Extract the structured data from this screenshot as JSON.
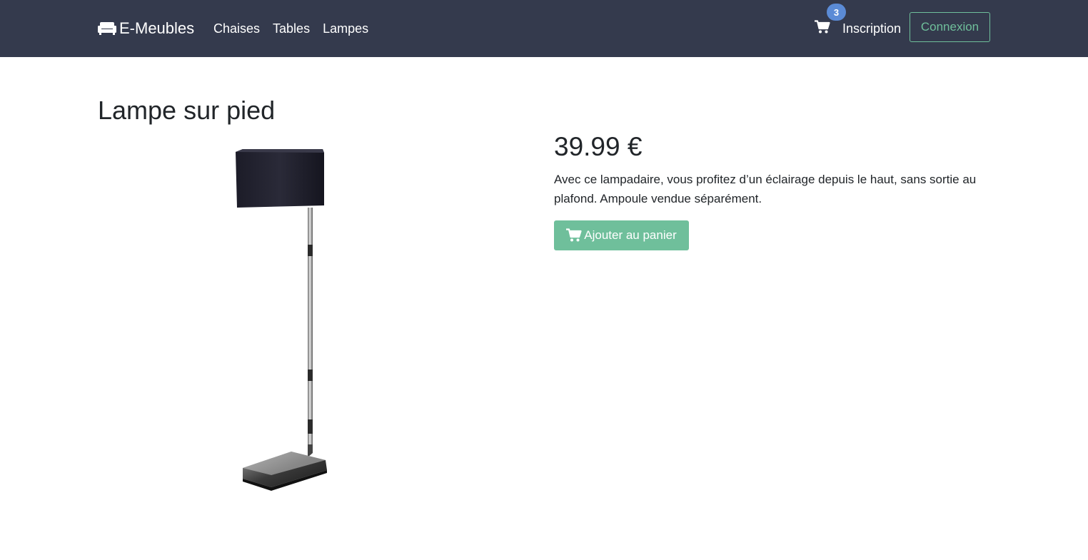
{
  "navbar": {
    "brand": "E-Meubles",
    "brand_icon": "couch-icon",
    "links": [
      "Chaises",
      "Tables",
      "Lampes"
    ],
    "cart_icon": "cart-icon",
    "cart_count": "3",
    "signup_label": "Inscription",
    "login_label": "Connexion",
    "accent_color": "#6fbf9b",
    "background_color": "#343a4d"
  },
  "product": {
    "title": "Lampe sur pied",
    "price": "39.99 €",
    "description": "Avec ce lampadaire, vous profitez d’un éclairage depuis le haut, sans sortie au plafond. Ampoule vendue séparément.",
    "add_to_cart_label": "Ajouter au panier",
    "image_icon": "floor-lamp-image"
  }
}
